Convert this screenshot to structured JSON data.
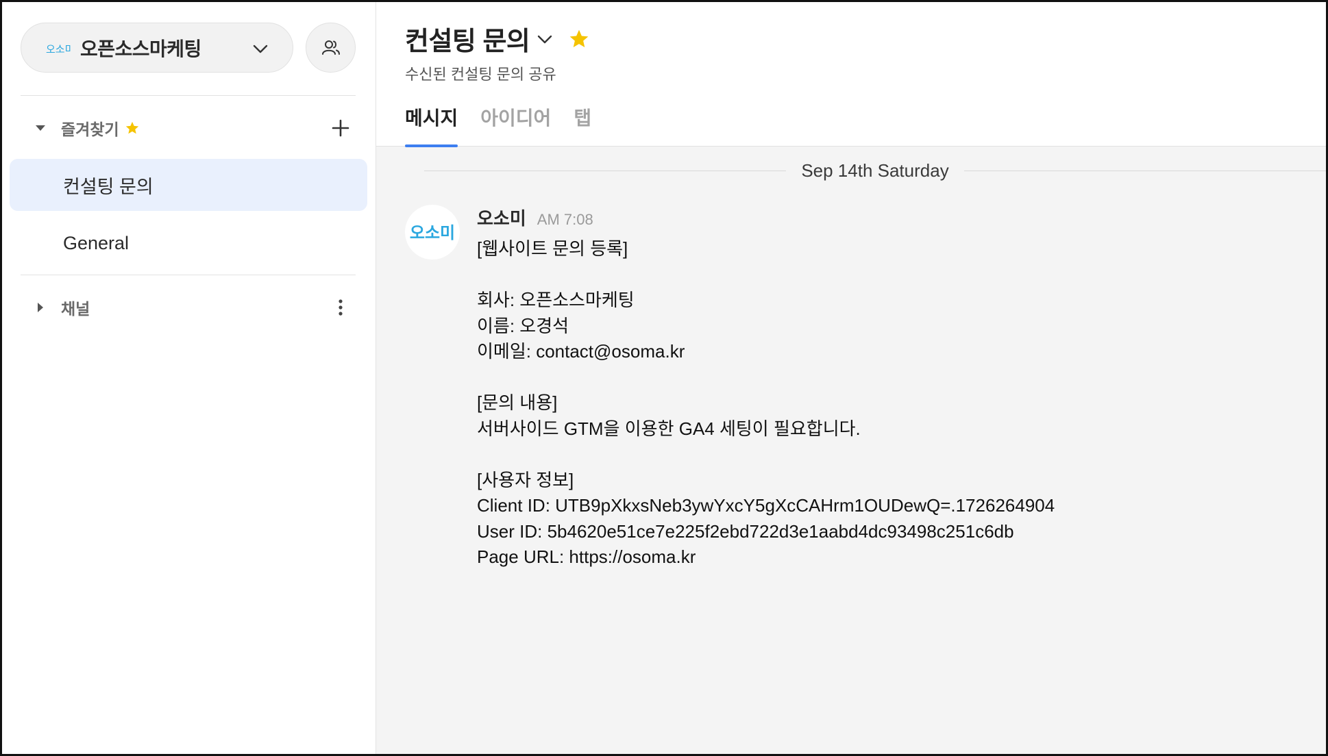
{
  "workspace": {
    "name": "오픈소스마케팅",
    "logo_text": "오소미",
    "accent": "#2aa7df"
  },
  "sidebar": {
    "favorites": {
      "title": "즐겨찾기",
      "items": [
        {
          "label": "컨설팅 문의",
          "active": true
        },
        {
          "label": "General",
          "active": false
        }
      ]
    },
    "channels": {
      "title": "채널"
    }
  },
  "channel": {
    "title": "컨설팅 문의",
    "subtitle": "수신된 컨설팅 문의 공유",
    "tabs": [
      {
        "label": "메시지",
        "active": true
      },
      {
        "label": "아이디어",
        "active": false
      },
      {
        "label": "탭",
        "active": false
      }
    ]
  },
  "feed": {
    "date_divider": "Sep 14th Saturday",
    "message": {
      "sender": "오소미",
      "time": "AM 7:08",
      "lines": [
        "[웹사이트 문의 등록]",
        "",
        "회사: 오픈소스마케팅",
        "이름: 오경석",
        "이메일: contact@osoma.kr",
        "",
        "[문의 내용]",
        "서버사이드 GTM을 이용한 GA4 세팅이 필요합니다.",
        "",
        "[사용자 정보]",
        "Client ID: UTB9pXkxsNeb3ywYxcY5gXcCAHrm1OUDewQ=.1726264904",
        "User ID: 5b4620e51ce7e225f2ebd722d3e1aabd4dc93498c251c6db",
        "Page URL: https://osoma.kr"
      ]
    }
  },
  "colors": {
    "star": "#f5c300",
    "active_tab": "#3d7ef0",
    "active_channel_bg": "#e9f0fd"
  },
  "icons": {
    "workspace_dropdown": "chevron-down-icon",
    "members": "people-icon",
    "favorites_toggle": "caret-down-icon",
    "favorites_add": "plus-icon",
    "channels_toggle": "caret-right-icon",
    "channels_more": "more-vertical-icon",
    "title_star": "star-icon"
  }
}
